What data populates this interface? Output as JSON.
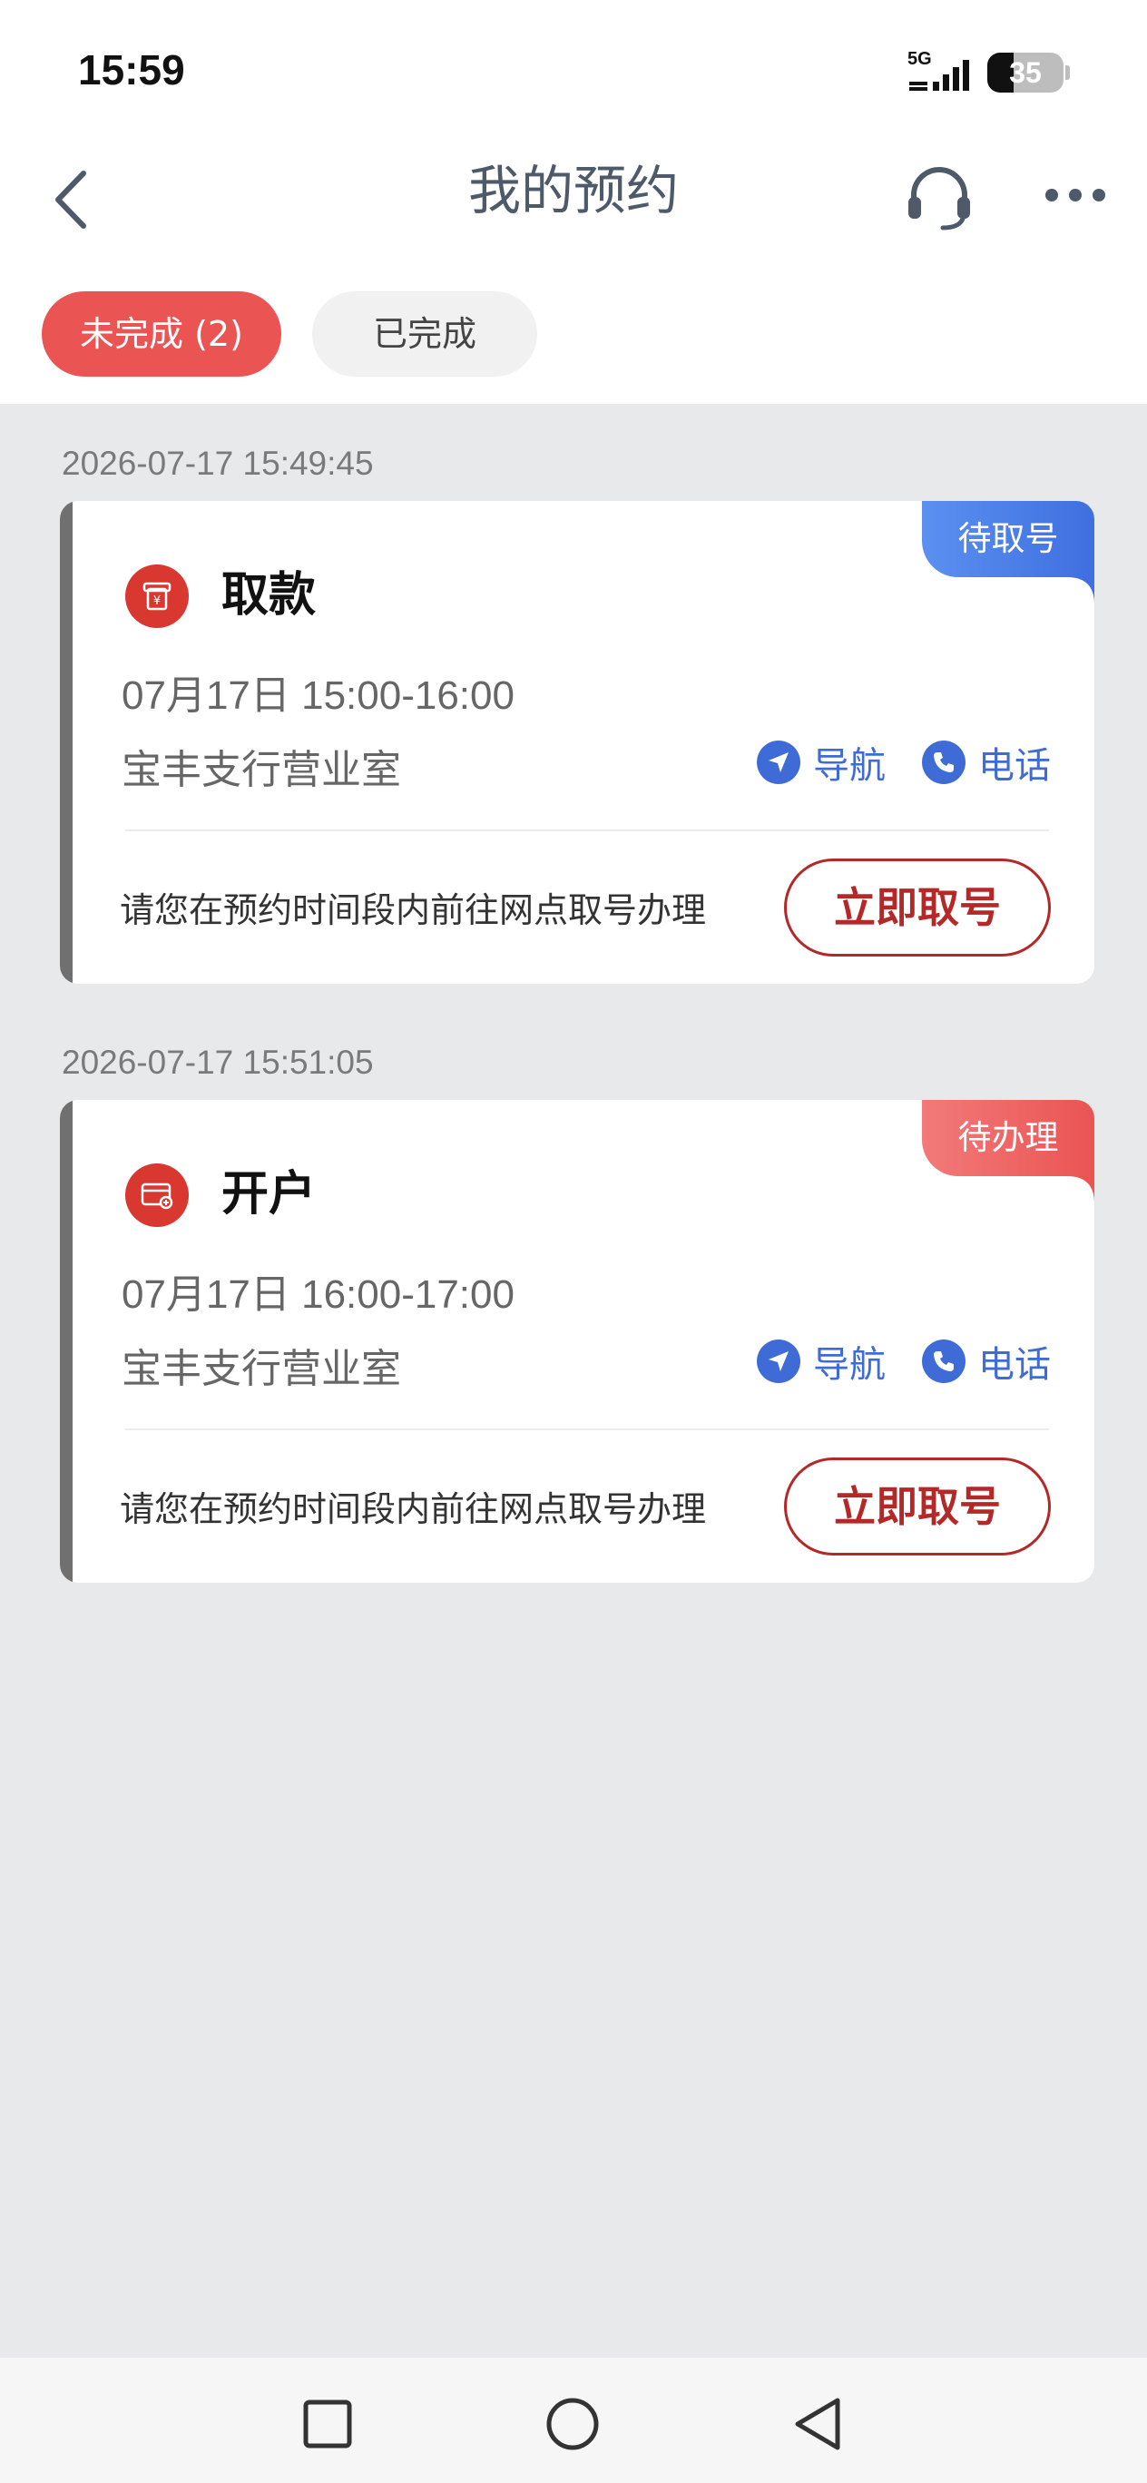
{
  "status_bar": {
    "time": "15:59",
    "network": "5G",
    "battery": "35",
    "battery_level": 0.35
  },
  "header": {
    "title": "我的预约",
    "back_icon": "chevron-left-icon",
    "support_icon": "headset-icon",
    "more_icon": "more-dots-icon"
  },
  "tabs": [
    {
      "label": "未完成 (2)",
      "active": true
    },
    {
      "label": "已完成",
      "active": false
    }
  ],
  "appointments": [
    {
      "submitted_at": "2026-07-17 15:49:45",
      "status": "待取号",
      "status_color": "#4a7fe8",
      "service": "取款",
      "service_icon": "withdraw-icon",
      "time_slot": "07月17日 15:00-16:00",
      "branch": "宝丰支行营业室",
      "nav_label": "导航",
      "phone_label": "电话",
      "hint": "请您在预约时间段内前往网点取号办理",
      "action_label": "立即取号"
    },
    {
      "submitted_at": "2026-07-17 15:51:05",
      "status": "待办理",
      "status_color": "#ea5453",
      "service": "开户",
      "service_icon": "card-icon",
      "time_slot": "07月17日 16:00-17:00",
      "branch": "宝丰支行营业室",
      "nav_label": "导航",
      "phone_label": "电话",
      "hint": "请您在预约时间段内前往网点取号办理",
      "action_label": "立即取号"
    }
  ],
  "colors": {
    "accent_red": "#ea5453",
    "button_red": "#b42828",
    "link_blue": "#3e6bd6",
    "background": "#e8e9eb"
  }
}
